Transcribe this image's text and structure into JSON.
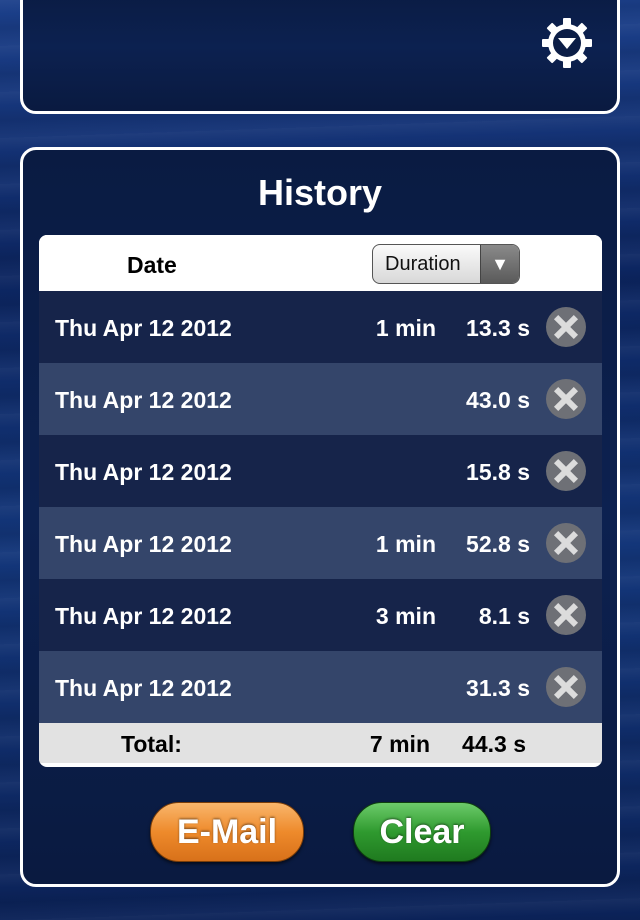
{
  "settings": {
    "icon": "gear-dropdown-icon"
  },
  "history": {
    "title": "History",
    "columns": {
      "date": "Date",
      "sort_select": "Duration",
      "sort_arrow": "▼"
    },
    "rows": [
      {
        "date": "Thu Apr 12 2012",
        "min": "1 min",
        "sec": "13.3 s"
      },
      {
        "date": "Thu Apr 12 2012",
        "min": "",
        "sec": "43.0 s"
      },
      {
        "date": "Thu Apr 12 2012",
        "min": "",
        "sec": "15.8 s"
      },
      {
        "date": "Thu Apr 12 2012",
        "min": "1 min",
        "sec": "52.8 s"
      },
      {
        "date": "Thu Apr 12 2012",
        "min": "3 min",
        "sec": "8.1 s"
      },
      {
        "date": "Thu Apr 12 2012",
        "min": "",
        "sec": "31.3 s"
      }
    ],
    "total": {
      "label": "Total:",
      "min": "7 min",
      "sec": "44.3 s"
    }
  },
  "buttons": {
    "email": "E-Mail",
    "clear": "Clear"
  }
}
